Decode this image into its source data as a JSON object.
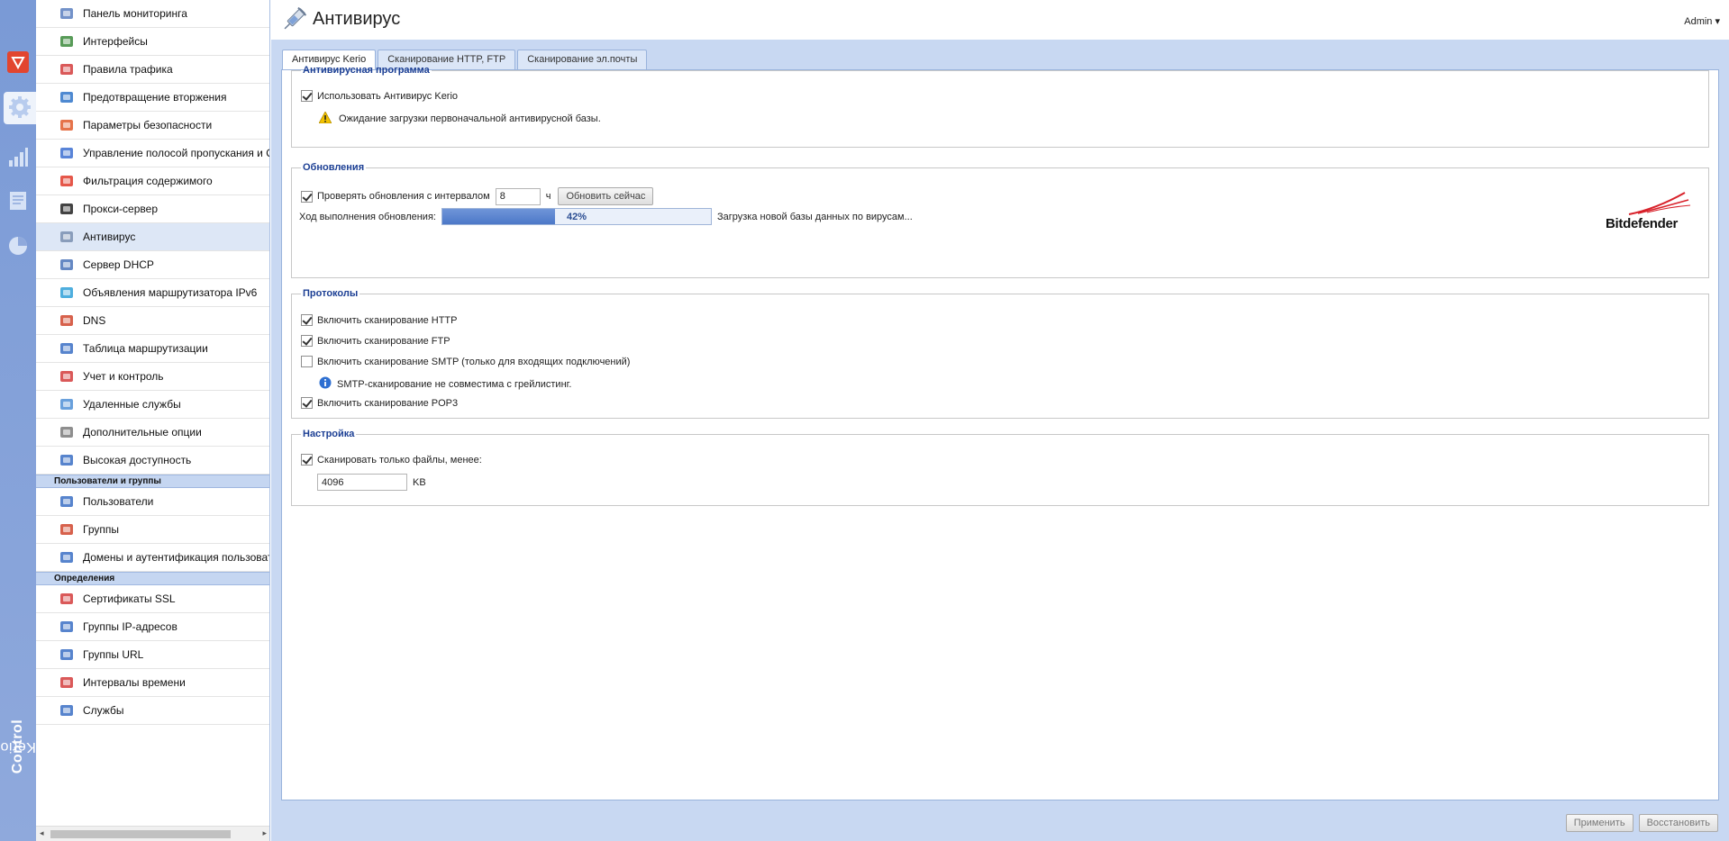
{
  "appbar": {
    "items": [
      {
        "icon": "shield-red-icon"
      },
      {
        "icon": "gear-icon"
      },
      {
        "icon": "bar-chart-icon"
      },
      {
        "icon": "log-icon"
      },
      {
        "icon": "pie-chart-icon"
      }
    ],
    "brand_light": "Kerio",
    "brand_bold": "Control"
  },
  "nav": {
    "items": [
      {
        "label": "Панель мониторинга",
        "icon": "dashboard-icon"
      },
      {
        "label": "Интерфейсы",
        "icon": "interfaces-icon"
      },
      {
        "label": "Правила трафика",
        "icon": "traffic-rules-icon"
      },
      {
        "label": "Предотвращение вторжения",
        "icon": "intrusion-shield-icon"
      },
      {
        "label": "Параметры безопасности",
        "icon": "security-hand-icon"
      },
      {
        "label": "Управление полосой пропускания и QoS",
        "icon": "bandwidth-icon"
      },
      {
        "label": "Фильтрация содержимого",
        "icon": "filter-icon"
      },
      {
        "label": "Прокси-сервер",
        "icon": "proxy-icon"
      },
      {
        "label": "Антивирус",
        "icon": "antivirus-syringe-icon"
      },
      {
        "label": "Сервер DHCP",
        "icon": "dhcp-icon"
      },
      {
        "label": "Объявления маршрутизатора IPv6",
        "icon": "ipv6-icon"
      },
      {
        "label": "DNS",
        "icon": "dns-icon"
      },
      {
        "label": "Таблица маршрутизации",
        "icon": "routing-table-icon"
      },
      {
        "label": "Учет и контроль",
        "icon": "accounting-icon"
      },
      {
        "label": "Удаленные службы",
        "icon": "cloud-icon"
      },
      {
        "label": "Дополнительные опции",
        "icon": "options-icon"
      },
      {
        "label": "Высокая доступность",
        "icon": "high-availability-icon"
      }
    ],
    "group_users": "Пользователи и группы",
    "users_items": [
      {
        "label": "Пользователи",
        "icon": "user-icon"
      },
      {
        "label": "Группы",
        "icon": "group-icon"
      },
      {
        "label": "Домены и аутентификация пользователей",
        "icon": "domain-icon"
      }
    ],
    "group_definitions": "Определения",
    "definition_items": [
      {
        "label": "Сертификаты SSL",
        "icon": "certificate-icon"
      },
      {
        "label": "Группы IP-адресов",
        "icon": "ip-group-icon"
      },
      {
        "label": "Группы URL",
        "icon": "url-group-icon"
      },
      {
        "label": "Интервалы времени",
        "icon": "clock-icon"
      },
      {
        "label": "Службы",
        "icon": "services-icon"
      }
    ],
    "selected": "Антивирус"
  },
  "header": {
    "title": "Антивирус",
    "user": "Admin ▾"
  },
  "tabs": [
    {
      "label": "Антивирус Kerio",
      "active": true
    },
    {
      "label": "Сканирование HTTP, FTP",
      "active": false
    },
    {
      "label": "Сканирование эл.почты",
      "active": false
    }
  ],
  "antivirus_section": {
    "legend": "Антивирусная программа",
    "use_kerio_label": "Использовать Антивирус Kerio",
    "use_kerio_checked": true,
    "warning_text": "Ожидание загрузки первоначальной антивирусной базы."
  },
  "updates_section": {
    "legend": "Обновления",
    "check_label": "Проверять обновления с интервалом",
    "check_checked": true,
    "interval_value": "8",
    "interval_unit": "ч",
    "update_now_button": "Обновить сейчас",
    "progress_label": "Ход выполнения обновления:",
    "progress_percent": 42,
    "progress_text": "42%",
    "status_text": "Загрузка новой базы данных по вирусам...",
    "vendor_logo": "Bitdefender"
  },
  "protocols_section": {
    "legend": "Протоколы",
    "items": [
      {
        "label": "Включить сканирование HTTP",
        "checked": true
      },
      {
        "label": "Включить сканирование FTP",
        "checked": true
      },
      {
        "label": "Включить сканирование SMTP (только для входящих подключений)",
        "checked": false
      },
      {
        "label": "Включить сканирование POP3",
        "checked": true
      }
    ],
    "smtp_info": "SMTP-сканирование не совместима с грейлистинг."
  },
  "settings_section": {
    "legend": "Настройка",
    "scan_limit_label": "Сканировать только файлы, менее:",
    "scan_limit_checked": true,
    "size_value": "4096",
    "size_unit": "KB"
  },
  "footer": {
    "apply": "Применить",
    "restore": "Восстановить"
  }
}
